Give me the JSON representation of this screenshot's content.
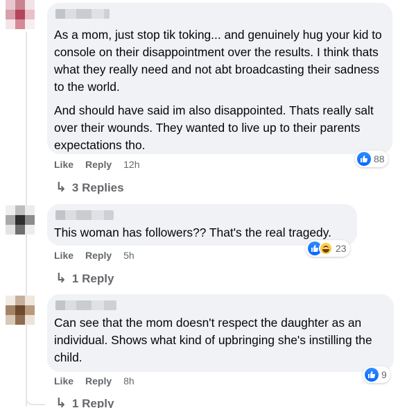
{
  "comments": [
    {
      "author_name": "",
      "paragraphs": [
        "As a mom, just stop tik toking... and genuinely hug your kid to console on their disappointment over the results. I think thats what they really need and not abt broadcasting their sadness to the world.",
        "And should have said im also disappointed. Thats really salt over their wounds. They wanted to live up to their parents expectations tho."
      ],
      "reactions": {
        "types": [
          "like"
        ],
        "count": "88"
      },
      "like_label": "Like",
      "reply_label": "Reply",
      "time": "12h",
      "replies_label": "3 Replies"
    },
    {
      "author_name": "",
      "paragraphs": [
        "This woman has followers?? That's the real tragedy."
      ],
      "reactions": {
        "types": [
          "like",
          "haha"
        ],
        "count": "23"
      },
      "like_label": "Like",
      "reply_label": "Reply",
      "time": "5h",
      "replies_label": "1 Reply"
    },
    {
      "author_name": "",
      "paragraphs": [
        "Can see that the mom doesn't respect the daughter as an individual. Shows what kind of upbringing she's instilling the child."
      ],
      "reactions": {
        "types": [
          "like"
        ],
        "count": "9"
      },
      "like_label": "Like",
      "reply_label": "Reply",
      "time": "8h",
      "replies_label": "1 Reply"
    }
  ],
  "colors": {
    "bubble_bg": "#f0f2f5",
    "secondary_text": "#65676b",
    "like_blue": "#0866ff"
  }
}
